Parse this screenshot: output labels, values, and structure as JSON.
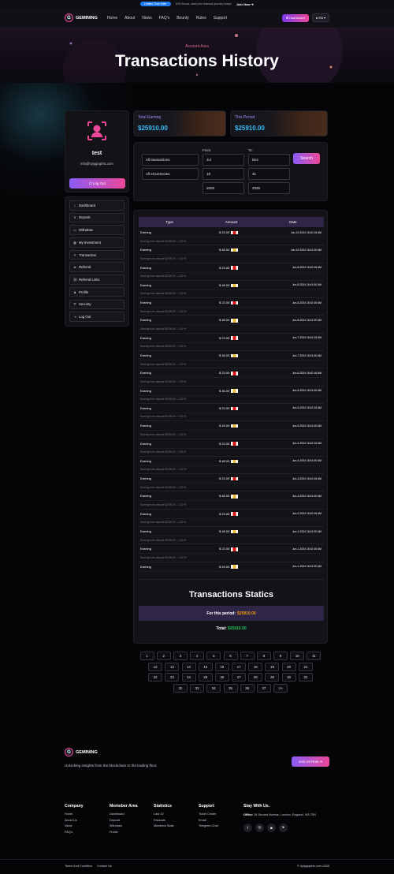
{
  "topbar": {
    "badge": "Limited Time Offer",
    "message": "10% Bonus, start your financial journey today!",
    "join": "Join Now ➔"
  },
  "nav": {
    "brand": "GEMINING",
    "logo_letter": "G",
    "menu": [
      "Home",
      "About",
      "News",
      "FAQ's",
      "Bounty",
      "Rules",
      "Support"
    ],
    "dashboard_label": "⊞ Dashboard",
    "lang_label": "● EN ▾"
  },
  "hero": {
    "crumb": "Account Area",
    "title": "Transactions History"
  },
  "profile": {
    "name": "test",
    "email": "info@hyipgraphic.com",
    "logout_label": "⏻ Log Out"
  },
  "sidebar": {
    "items": [
      {
        "icon": "⌂",
        "label": "Dashboard"
      },
      {
        "icon": "$",
        "label": "Deposit"
      },
      {
        "icon": "▭",
        "label": "Withdraw"
      },
      {
        "icon": "▦",
        "label": "My Investment"
      },
      {
        "icon": "✎",
        "label": "Transaction"
      },
      {
        "icon": "⇄",
        "label": "Referral"
      },
      {
        "icon": "⛓",
        "label": "Referral Links"
      },
      {
        "icon": "♟",
        "label": "Profile"
      },
      {
        "icon": "⛨",
        "label": "Security"
      },
      {
        "icon": "⇥",
        "label": "Log Out"
      }
    ]
  },
  "stats": {
    "total_label": "Total Earning",
    "total_value": "$25910.00",
    "period_label": "This Period",
    "period_value": "$25910.00"
  },
  "filter": {
    "type": "All transactions",
    "currency": "All eCurrencies",
    "from_label": "From:",
    "to_label": "To:",
    "from_month": "Jul",
    "from_day": "18",
    "from_year": "2020",
    "to_month": "Dec",
    "to_day": "31",
    "to_year": "2025",
    "search_label": "Search"
  },
  "table": {
    "headers": [
      "Type",
      "Amount",
      "Date"
    ],
    "rows": [
      {
        "type": "Earning",
        "amount": "$ 23.00",
        "flag": "red",
        "date": "Jun-19-2024 16:42:16 AM",
        "desc": "Earning from deposit $1000.00 - 2.30 %"
      },
      {
        "type": "Earning",
        "amount": "$ 46.00",
        "flag": "gold",
        "date": "Jun-19-2024 16:41:00 AM",
        "desc": "Earning from deposit $2000.00 - 2.40 %"
      },
      {
        "type": "Earning",
        "amount": "$ 23.00",
        "flag": "red",
        "date": "Jun-8-2024 16:42:16 AM",
        "desc": "Earning from deposit $1000.00 - 2.30 %"
      },
      {
        "type": "Earning",
        "amount": "$ 48.00",
        "flag": "gold",
        "date": "Jun-8-2024 16:41:00 AM",
        "desc": "Earning from deposit $2000.00 - 2.40 %"
      },
      {
        "type": "Earning",
        "amount": "$ 23.00",
        "flag": "red",
        "date": "Jun-8-2024 16:42:16 AM",
        "desc": "Earning from deposit $1000.00 - 2.30 %"
      },
      {
        "type": "Earning",
        "amount": "$ 48.00",
        "flag": "gold",
        "date": "Jun-8-2024 16:41:00 AM",
        "desc": "Earning from deposit $2000.00 - 2.40 %"
      },
      {
        "type": "Earning",
        "amount": "$ 23.00",
        "flag": "red",
        "date": "Jun-7-2024 16:42:16 AM",
        "desc": "Earning from deposit $1000.00 - 2.30 %"
      },
      {
        "type": "Earning",
        "amount": "$ 48.00",
        "flag": "gold",
        "date": "Jun-7-2024 16:41:00 AM",
        "desc": "Earning from deposit $2000.00 - 2.40 %"
      },
      {
        "type": "Earning",
        "amount": "$ 23.00",
        "flag": "red",
        "date": "Jun-6-2024 16:42:16 AM",
        "desc": "Earning from deposit $1000.00 - 2.30 %"
      },
      {
        "type": "Earning",
        "amount": "$ 46.00",
        "flag": "gold",
        "date": "Jun-6-2024 16:41:00 AM",
        "desc": "Earning from deposit $2000.00 - 2.30 %"
      },
      {
        "type": "Earning",
        "amount": "$ 23.00",
        "flag": "red",
        "date": "Jun-5-2024 16:42:16 AM",
        "desc": "Earning from deposit $1000.00 - 2.30 %"
      },
      {
        "type": "Earning",
        "amount": "$ 49.00",
        "flag": "gold",
        "date": "Jun-5-2024 16:41:00 AM",
        "desc": "Earning from deposit $2000.00 - 2.40 %"
      },
      {
        "type": "Earning",
        "amount": "$ 23.00",
        "flag": "red",
        "date": "Jun-4-2024 16:42:16 AM",
        "desc": "Earning from deposit $1000.00 - 2.30 %"
      },
      {
        "type": "Earning",
        "amount": "$ 48.00",
        "flag": "gold",
        "date": "Jun-4-2024 16:41:00 AM",
        "desc": "Earning from deposit $2000.00 - 2.40 %"
      },
      {
        "type": "Earning",
        "amount": "$ 23.00",
        "flag": "red",
        "date": "Jun-3-2024 16:42:16 AM",
        "desc": "Earning from deposit $1000.00 - 2.30 %"
      },
      {
        "type": "Earning",
        "amount": "$ 46.00",
        "flag": "gold",
        "date": "Jun-3-2024 16:41:00 AM",
        "desc": "Earning from deposit $2000.00 - 2.30 %"
      },
      {
        "type": "Earning",
        "amount": "$ 23.00",
        "flag": "red",
        "date": "Jun-2-2024 16:42:16 AM",
        "desc": "Earning from deposit $1000.00 - 2.30 %"
      },
      {
        "type": "Earning",
        "amount": "$ 48.00",
        "flag": "gold",
        "date": "Jun-2-2024 16:41:00 AM",
        "desc": "Earning from deposit $2000.00 - 2.40 %"
      },
      {
        "type": "Earning",
        "amount": "$ 23.00",
        "flag": "red",
        "date": "Jun-1-2024 16:42:16 AM",
        "desc": "Earning from deposit $1000.00 - 2.30 %"
      },
      {
        "type": "Earning",
        "amount": "$ 49.00",
        "flag": "gold",
        "date": "Jun-1-2024 16:41:00 AM",
        "desc": ""
      }
    ]
  },
  "statics": {
    "title": "Transactions Statics",
    "period_label": "For this period:",
    "period_value": "$25910.00",
    "total_label": "Total:",
    "total_value": "$25910.00"
  },
  "pagination": {
    "rows": [
      [
        "1",
        "2",
        "3",
        "4",
        "5",
        "6",
        "7",
        "8",
        "9",
        "10",
        "11"
      ],
      [
        "12",
        "13",
        "14",
        "15",
        "16",
        "17",
        "18",
        "19",
        "20",
        "21"
      ],
      [
        "22",
        "23",
        "24",
        "25",
        "26",
        "27",
        "28",
        "29",
        "30",
        "31"
      ],
      [
        "32",
        "33",
        "34",
        "35",
        "36",
        "37",
        ">>"
      ]
    ]
  },
  "footer": {
    "brand": "GEMINING",
    "tagline": "Unlocking insights from the blockchain to the trading floor.",
    "join_label": "Join Us Now ➔",
    "columns": [
      {
        "title": "Company",
        "links": [
          "Home",
          "About Us",
          "News",
          "FAQ's"
        ]
      },
      {
        "title": "Memeber Area",
        "links": [
          "Dashboard",
          "Deposit",
          "Withdraw",
          "Profile"
        ]
      },
      {
        "title": "Statistics",
        "links": [
          "Last 10",
          "Paidouts",
          "Members Stats"
        ]
      },
      {
        "title": "Support",
        "links": [
          "Ticket Center",
          "Email",
          "Telegram Chat"
        ]
      }
    ],
    "stay_title": "Stay With Us.",
    "office_label": "Office:",
    "office_address": "28 Second Avenue, London, England, W3 7RX",
    "socials": [
      "f",
      "◎",
      "◙",
      "➤"
    ],
    "terms": "Terms And Condition",
    "contact": "Contact Us",
    "copyright": "© hyipgraphic.com 2025"
  }
}
